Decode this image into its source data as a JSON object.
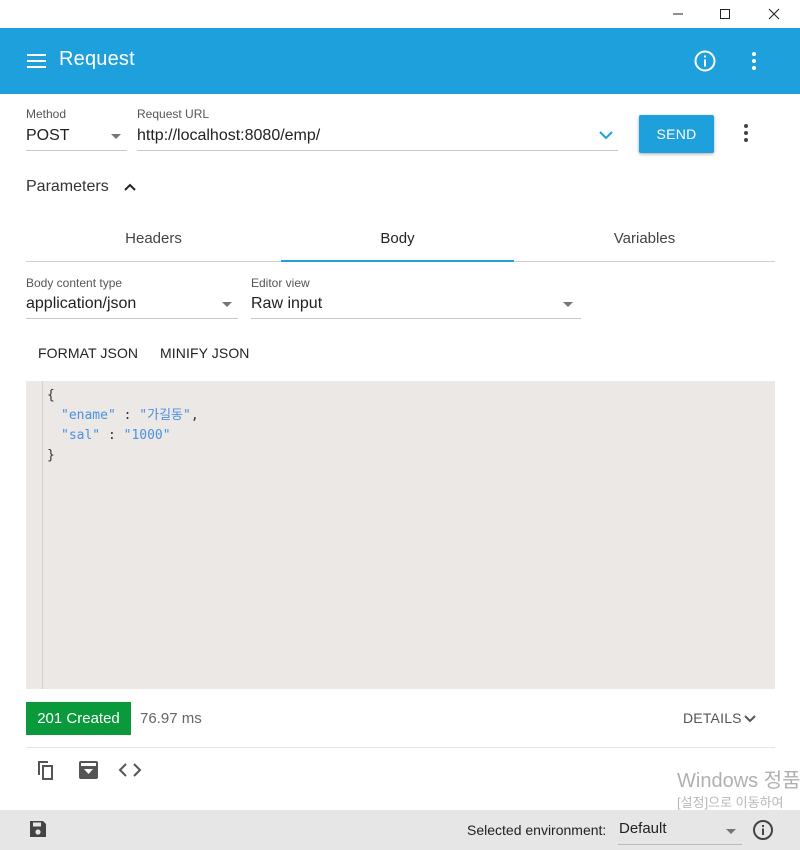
{
  "window": {
    "minimize_icon": "minimize-icon",
    "maximize_icon": "maximize-icon",
    "close_icon": "close-icon"
  },
  "appbar": {
    "title": "Request",
    "color": "#1ea0dc"
  },
  "request": {
    "method_label": "Method",
    "method_value": "POST",
    "url_label": "Request URL",
    "url_value": "http://localhost:8080/emp/",
    "send_label": "SEND"
  },
  "parameters": {
    "label": "Parameters"
  },
  "tabs": [
    {
      "label": "Headers",
      "active": false
    },
    {
      "label": "Body",
      "active": true
    },
    {
      "label": "Variables",
      "active": false
    }
  ],
  "body": {
    "content_type_label": "Body content type",
    "content_type_value": "application/json",
    "editor_view_label": "Editor view",
    "editor_view_value": "Raw input",
    "format_label": "FORMAT JSON",
    "minify_label": "MINIFY JSON",
    "code": {
      "open": "{",
      "ename_key": "\"ename\"",
      "sep1": " : ",
      "ename_val": "\"가길동\"",
      "comma": ",",
      "sal_key": "\"sal\"",
      "sep2": " : ",
      "sal_val": "\"1000\"",
      "close": "}"
    }
  },
  "response": {
    "status": "201 Created",
    "status_color": "#0a9a3c",
    "time": "76.97 ms",
    "details_label": "DETAILS"
  },
  "watermark": {
    "line1": "Windows 정품",
    "line2": "[설정]으로 이동하여"
  },
  "footer": {
    "env_label": "Selected environment:",
    "env_value": "Default"
  }
}
